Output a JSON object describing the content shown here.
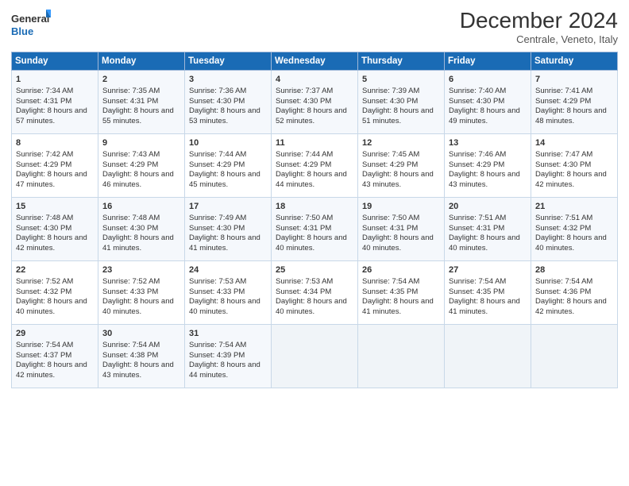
{
  "logo": {
    "line1": "General",
    "line2": "Blue"
  },
  "title": "December 2024",
  "subtitle": "Centrale, Veneto, Italy",
  "headers": [
    "Sunday",
    "Monday",
    "Tuesday",
    "Wednesday",
    "Thursday",
    "Friday",
    "Saturday"
  ],
  "weeks": [
    [
      {
        "day": "1",
        "sunrise": "7:34 AM",
        "sunset": "4:31 PM",
        "daylight": "8 hours and 57 minutes."
      },
      {
        "day": "2",
        "sunrise": "7:35 AM",
        "sunset": "4:31 PM",
        "daylight": "8 hours and 55 minutes."
      },
      {
        "day": "3",
        "sunrise": "7:36 AM",
        "sunset": "4:30 PM",
        "daylight": "8 hours and 53 minutes."
      },
      {
        "day": "4",
        "sunrise": "7:37 AM",
        "sunset": "4:30 PM",
        "daylight": "8 hours and 52 minutes."
      },
      {
        "day": "5",
        "sunrise": "7:39 AM",
        "sunset": "4:30 PM",
        "daylight": "8 hours and 51 minutes."
      },
      {
        "day": "6",
        "sunrise": "7:40 AM",
        "sunset": "4:30 PM",
        "daylight": "8 hours and 49 minutes."
      },
      {
        "day": "7",
        "sunrise": "7:41 AM",
        "sunset": "4:29 PM",
        "daylight": "8 hours and 48 minutes."
      }
    ],
    [
      {
        "day": "8",
        "sunrise": "7:42 AM",
        "sunset": "4:29 PM",
        "daylight": "8 hours and 47 minutes."
      },
      {
        "day": "9",
        "sunrise": "7:43 AM",
        "sunset": "4:29 PM",
        "daylight": "8 hours and 46 minutes."
      },
      {
        "day": "10",
        "sunrise": "7:44 AM",
        "sunset": "4:29 PM",
        "daylight": "8 hours and 45 minutes."
      },
      {
        "day": "11",
        "sunrise": "7:44 AM",
        "sunset": "4:29 PM",
        "daylight": "8 hours and 44 minutes."
      },
      {
        "day": "12",
        "sunrise": "7:45 AM",
        "sunset": "4:29 PM",
        "daylight": "8 hours and 43 minutes."
      },
      {
        "day": "13",
        "sunrise": "7:46 AM",
        "sunset": "4:29 PM",
        "daylight": "8 hours and 43 minutes."
      },
      {
        "day": "14",
        "sunrise": "7:47 AM",
        "sunset": "4:30 PM",
        "daylight": "8 hours and 42 minutes."
      }
    ],
    [
      {
        "day": "15",
        "sunrise": "7:48 AM",
        "sunset": "4:30 PM",
        "daylight": "8 hours and 42 minutes."
      },
      {
        "day": "16",
        "sunrise": "7:48 AM",
        "sunset": "4:30 PM",
        "daylight": "8 hours and 41 minutes."
      },
      {
        "day": "17",
        "sunrise": "7:49 AM",
        "sunset": "4:30 PM",
        "daylight": "8 hours and 41 minutes."
      },
      {
        "day": "18",
        "sunrise": "7:50 AM",
        "sunset": "4:31 PM",
        "daylight": "8 hours and 40 minutes."
      },
      {
        "day": "19",
        "sunrise": "7:50 AM",
        "sunset": "4:31 PM",
        "daylight": "8 hours and 40 minutes."
      },
      {
        "day": "20",
        "sunrise": "7:51 AM",
        "sunset": "4:31 PM",
        "daylight": "8 hours and 40 minutes."
      },
      {
        "day": "21",
        "sunrise": "7:51 AM",
        "sunset": "4:32 PM",
        "daylight": "8 hours and 40 minutes."
      }
    ],
    [
      {
        "day": "22",
        "sunrise": "7:52 AM",
        "sunset": "4:32 PM",
        "daylight": "8 hours and 40 minutes."
      },
      {
        "day": "23",
        "sunrise": "7:52 AM",
        "sunset": "4:33 PM",
        "daylight": "8 hours and 40 minutes."
      },
      {
        "day": "24",
        "sunrise": "7:53 AM",
        "sunset": "4:33 PM",
        "daylight": "8 hours and 40 minutes."
      },
      {
        "day": "25",
        "sunrise": "7:53 AM",
        "sunset": "4:34 PM",
        "daylight": "8 hours and 40 minutes."
      },
      {
        "day": "26",
        "sunrise": "7:54 AM",
        "sunset": "4:35 PM",
        "daylight": "8 hours and 41 minutes."
      },
      {
        "day": "27",
        "sunrise": "7:54 AM",
        "sunset": "4:35 PM",
        "daylight": "8 hours and 41 minutes."
      },
      {
        "day": "28",
        "sunrise": "7:54 AM",
        "sunset": "4:36 PM",
        "daylight": "8 hours and 42 minutes."
      }
    ],
    [
      {
        "day": "29",
        "sunrise": "7:54 AM",
        "sunset": "4:37 PM",
        "daylight": "8 hours and 42 minutes."
      },
      {
        "day": "30",
        "sunrise": "7:54 AM",
        "sunset": "4:38 PM",
        "daylight": "8 hours and 43 minutes."
      },
      {
        "day": "31",
        "sunrise": "7:54 AM",
        "sunset": "4:39 PM",
        "daylight": "8 hours and 44 minutes."
      },
      null,
      null,
      null,
      null
    ]
  ]
}
